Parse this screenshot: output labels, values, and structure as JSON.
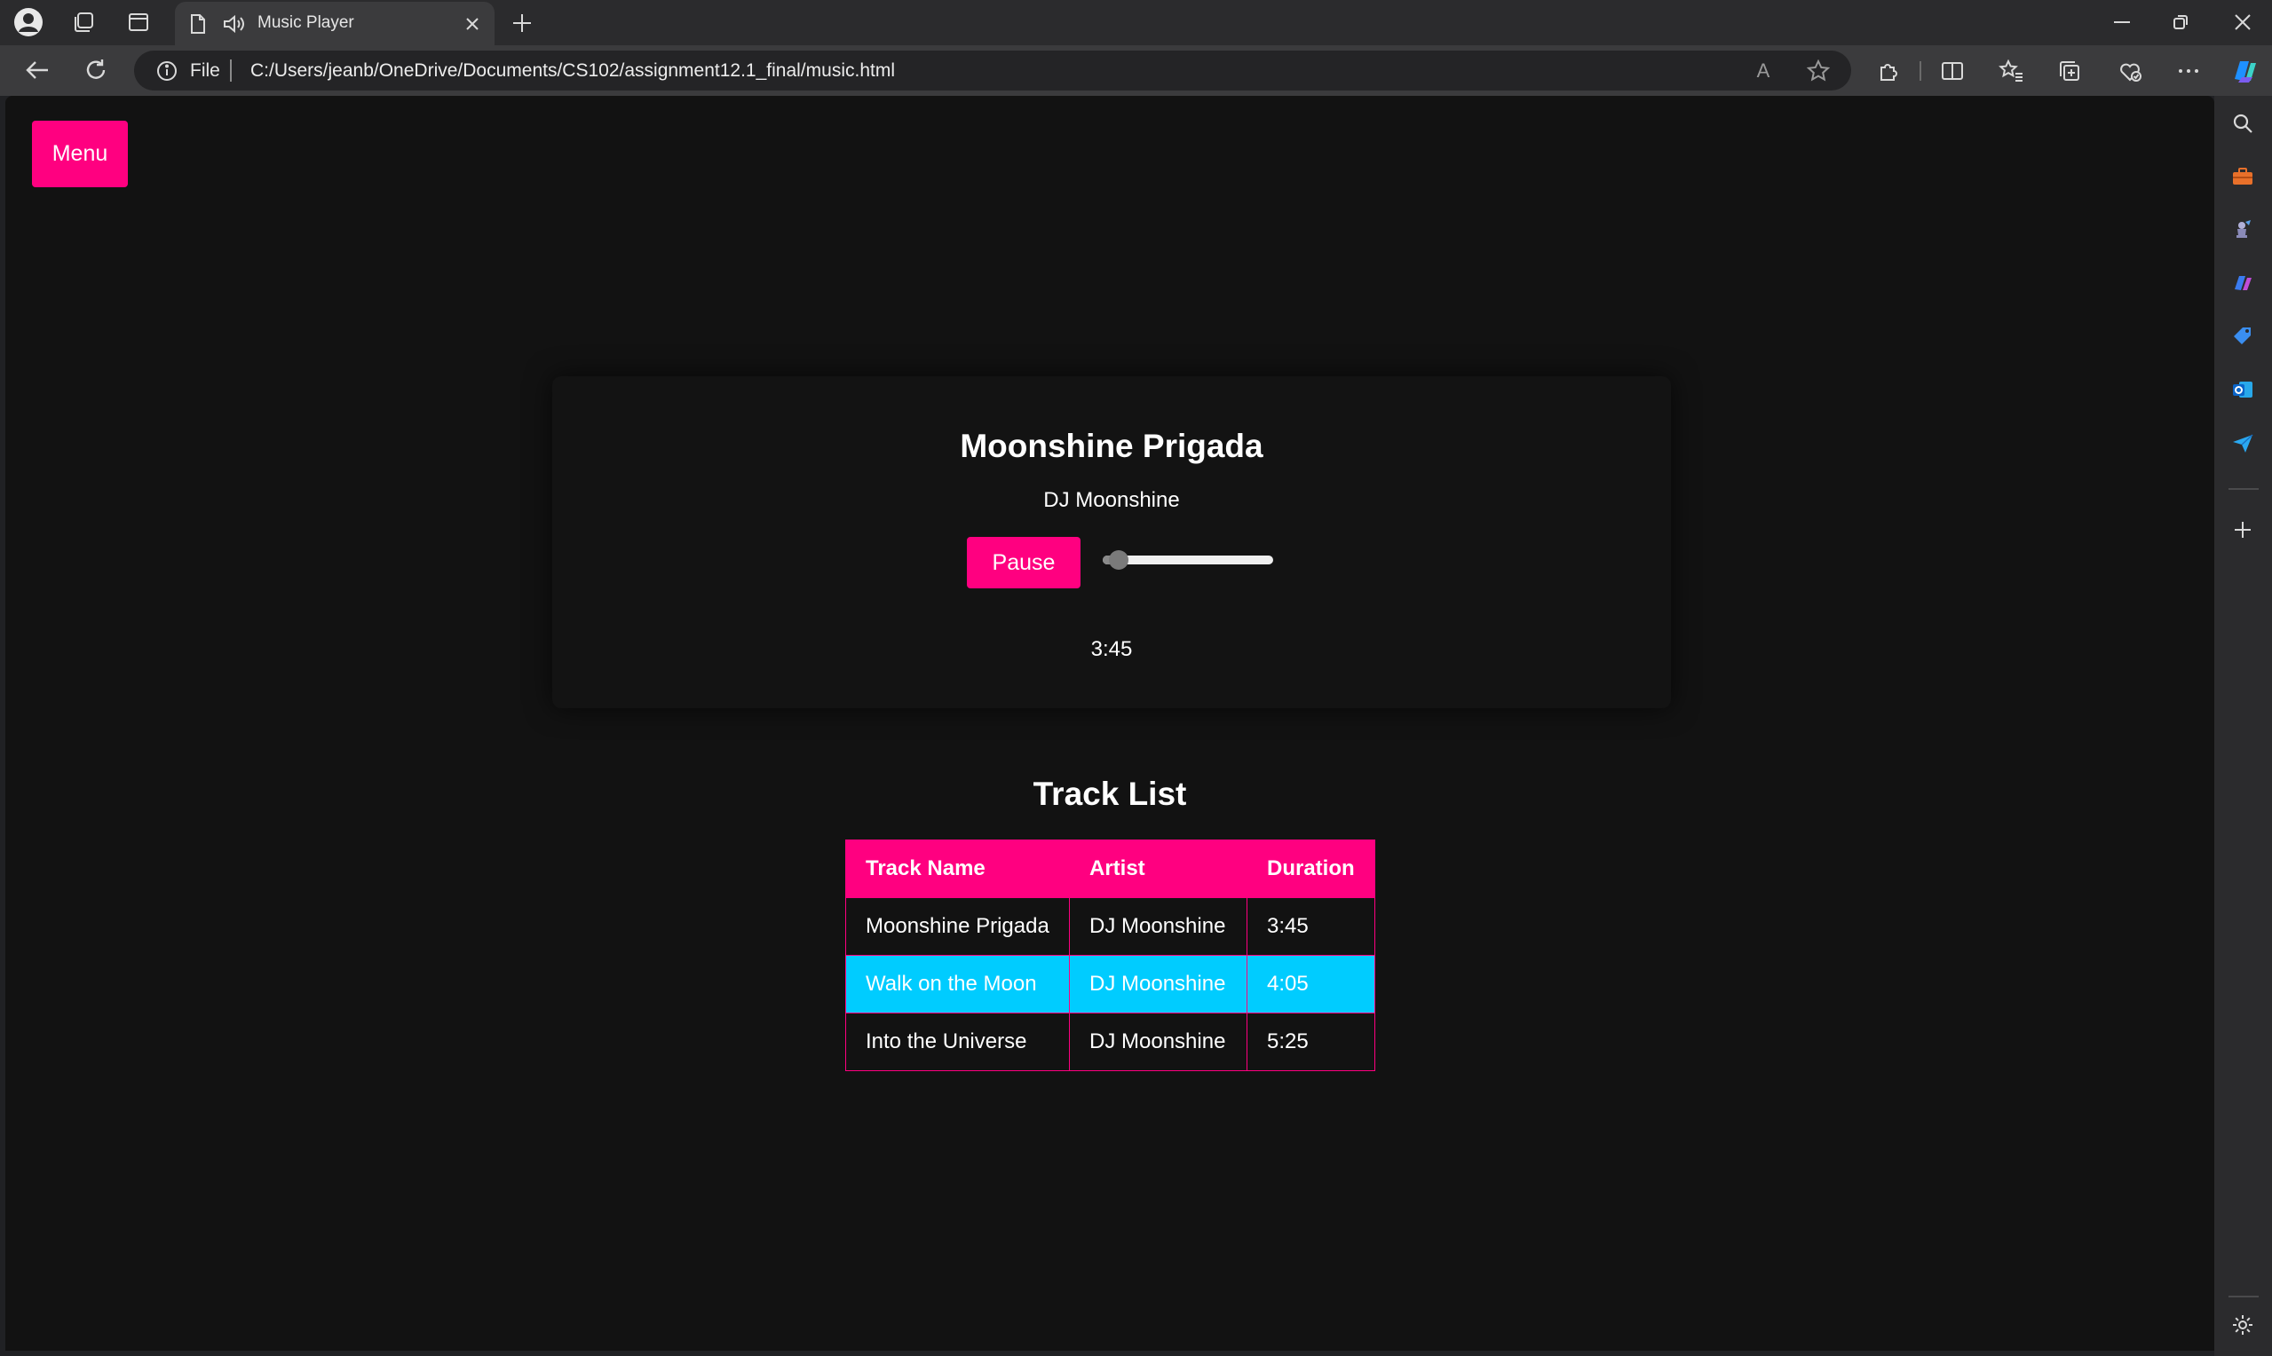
{
  "browser": {
    "tab_title": "Music Player",
    "address_scheme": "File",
    "address_url": "C:/Users/jeanb/OneDrive/Documents/CS102/assignment12.1_final/music.html",
    "read_aloud_label": "A"
  },
  "page": {
    "menu_label": "Menu",
    "player": {
      "title": "Moonshine Prigada",
      "artist": "DJ Moonshine",
      "pause_label": "Pause",
      "progress_fraction": 0.05,
      "time": "3:45"
    },
    "tracklist": {
      "heading": "Track List",
      "headers": [
        "Track Name",
        "Artist",
        "Duration"
      ],
      "rows": [
        {
          "name": "Moonshine Prigada",
          "artist": "DJ Moonshine",
          "duration": "3:45",
          "highlighted": false
        },
        {
          "name": "Walk on the Moon",
          "artist": "DJ Moonshine",
          "duration": "4:05",
          "highlighted": true
        },
        {
          "name": "Into the Universe",
          "artist": "DJ Moonshine",
          "duration": "5:25",
          "highlighted": false
        }
      ]
    }
  },
  "colors": {
    "accent": "#ff0080",
    "highlight": "#00ccff",
    "background": "#121212"
  }
}
